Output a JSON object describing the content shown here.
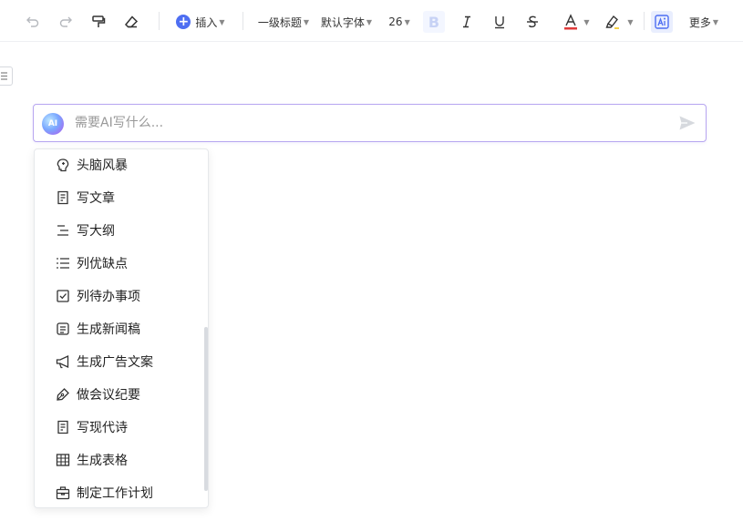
{
  "toolbar": {
    "insert_label": "插入",
    "heading_label": "一级标题",
    "font_label": "默认字体",
    "size_label": "26",
    "bold_label": "B",
    "more_label": "更多",
    "icons": [
      "undo-icon",
      "redo-icon",
      "format-painter-icon",
      "eraser-icon",
      "plus-icon",
      "bold-icon",
      "italic-icon",
      "underline-icon",
      "strikethrough-icon",
      "font-color-icon",
      "highlight-icon",
      "ai-write-icon"
    ],
    "font_color": "#e03a3a",
    "accent_color": "#4e6ef2"
  },
  "ai_input": {
    "logo_text": "AI",
    "placeholder": "需要AI写什么...",
    "value": "",
    "border_color": "#b7a6f0"
  },
  "menu": {
    "items": [
      {
        "label": "头脑风暴",
        "icon": "brain-icon"
      },
      {
        "label": "写文章",
        "icon": "document-icon"
      },
      {
        "label": "写大纲",
        "icon": "outline-icon"
      },
      {
        "label": "列优缺点",
        "icon": "list-icon"
      },
      {
        "label": "列待办事项",
        "icon": "checkbox-icon"
      },
      {
        "label": "生成新闻稿",
        "icon": "news-icon"
      },
      {
        "label": "生成广告文案",
        "icon": "megaphone-icon"
      },
      {
        "label": "做会议纪要",
        "icon": "pen-icon"
      },
      {
        "label": "写现代诗",
        "icon": "poem-icon"
      },
      {
        "label": "生成表格",
        "icon": "table-icon"
      },
      {
        "label": "制定工作计划",
        "icon": "briefcase-icon"
      }
    ]
  }
}
